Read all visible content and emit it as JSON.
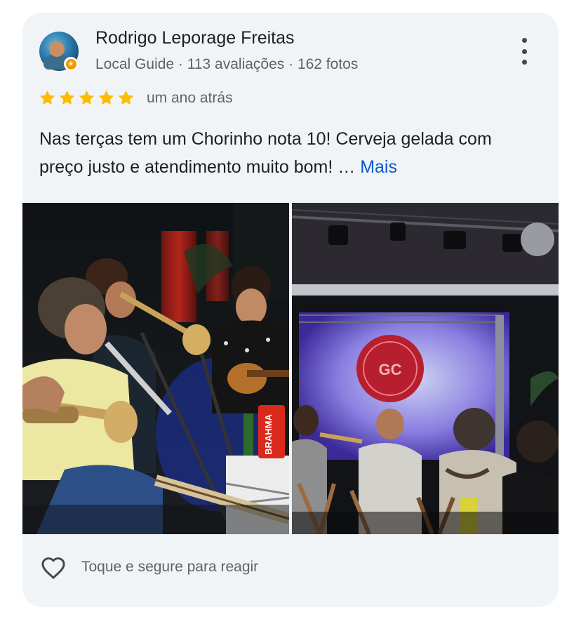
{
  "reviewer": {
    "name": "Rodrigo Leporage Freitas",
    "meta": "Local Guide · 113 avaliações · 162 fotos"
  },
  "review": {
    "stars": 5,
    "time": "um ano atrás",
    "text": "Nas terças tem um Chorinho nota 10! Cerveja gelada com preço justo e atendimento muito bom! …",
    "more_label": "Mais"
  },
  "photos": {
    "left_can_label": "BRAHMA",
    "right_banner_label": "GC"
  },
  "actions": {
    "react_label": "Toque e segure para reagir"
  },
  "colors": {
    "star": "#fbbc04",
    "link": "#0b57d0",
    "card_bg": "#f1f4f7"
  },
  "icons": {
    "menu": "more-vert-icon",
    "react": "heart-outline-icon",
    "badge": "local-guide-badge-icon"
  }
}
